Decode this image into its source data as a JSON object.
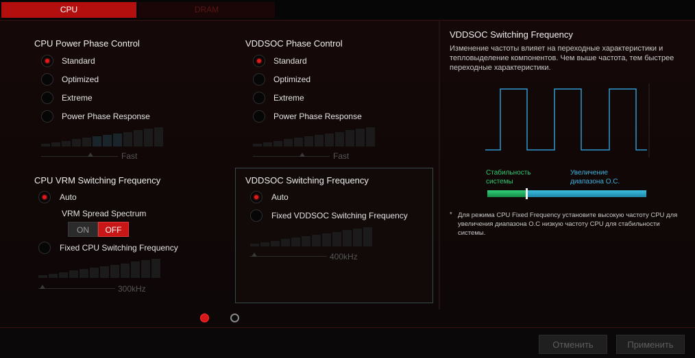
{
  "tabs": [
    {
      "label": "CPU",
      "active": true
    },
    {
      "label": "DRAM",
      "active": false
    }
  ],
  "cpu_power_phase": {
    "title": "CPU Power Phase Control",
    "options": [
      "Standard",
      "Optimized",
      "Extreme",
      "Power Phase Response"
    ],
    "selected": "Standard",
    "slider_label": "Fast"
  },
  "vddsoc_phase": {
    "title": "VDDSOC Phase Control",
    "options": [
      "Standard",
      "Optimized",
      "Extreme",
      "Power Phase Response"
    ],
    "selected": "Standard",
    "slider_label": "Fast"
  },
  "cpu_vrm": {
    "title": "CPU VRM Switching Frequency",
    "auto_label": "Auto",
    "auto_selected": true,
    "spread_label": "VRM Spread Spectrum",
    "toggle_on": "ON",
    "toggle_off": "OFF",
    "toggle_state": "OFF",
    "fixed_label": "Fixed CPU Switching Frequency",
    "slider_label": "300kHz"
  },
  "vddsoc_switching": {
    "title": "VDDSOC Switching Frequency",
    "auto_label": "Auto",
    "auto_selected": true,
    "fixed_label": "Fixed VDDSOC Switching Frequency",
    "slider_label": "400kHz"
  },
  "info": {
    "title": "VDDSOC Switching Frequency",
    "description": "Изменение частоты влияет на переходные характеристики и тепловыделение компонентов. Чем выше частота, тем быстрее переходные характеристики.",
    "left_label": "Стабильность системы",
    "right_label": "Увеличение диапазона O.C.",
    "note_mark": "*",
    "note": "Для режима CPU Fixed Frequency установите высокую частоту CPU для увеличения диапазона O.C низкую частоту CPU для стабильности системы."
  },
  "pagination": {
    "pages": 2,
    "current": 1
  },
  "footer": {
    "cancel_label": "Отменить",
    "apply_label": "Применить"
  },
  "colors": {
    "accent_red": "#c91717",
    "wave": "#2f9ad0",
    "green": "#1fb86a",
    "blue": "#3a9ec0"
  }
}
